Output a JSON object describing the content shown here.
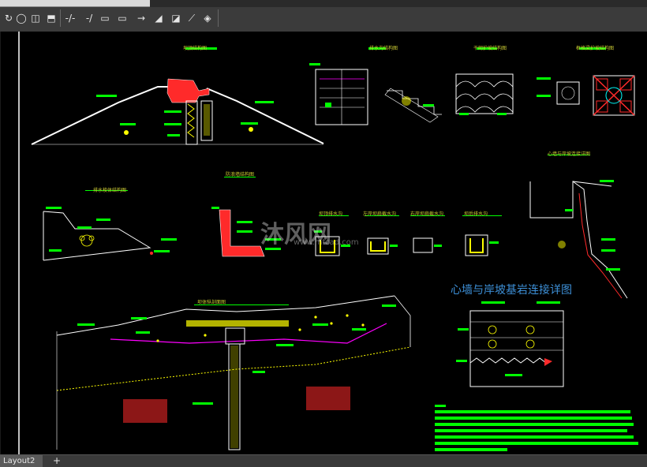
{
  "toolbar": {
    "tools": [
      "redo-icon",
      "undo-icon",
      "extra-icon",
      "cursor-icon",
      "orbit-icon",
      "rectangle-icon",
      "insert-icon",
      "trim-icon",
      "extend-icon",
      "break-icon",
      "join-icon",
      "chamfer-icon",
      "fillet-icon",
      "blend-icon",
      "explode-icon",
      "block-icon"
    ]
  },
  "drawing": {
    "headline": "心墙与岸坡基岩连接详图",
    "watermark": "沐风网",
    "watermark_sub": "www.mfcad.com",
    "labels": {
      "dam_section": "坝顶结构图",
      "drain_section": "排水沟结构图",
      "slope_protect": "干砌护坡结构图",
      "grid_slope": "框格梁护坡结构图",
      "downstream": "排水棱体结构图",
      "wave_wall": "防浪墙结构图",
      "ditch1": "坝顶排水沟",
      "ditch2": "左岸坝肩截水沟",
      "ditch3": "右岸坝肩截水沟",
      "ditch4": "坝后排水沟",
      "right_detail": "心墙与岸坡连接详图",
      "section_main": "坝体纵剖面图"
    },
    "colors": {
      "green": "#00ff00",
      "yellow": "#ffff00",
      "red": "#ff2a2a",
      "white": "#ffffff",
      "magenta": "#ff00ff",
      "cyan": "#00ffff",
      "blue": "#3d8fd6"
    }
  },
  "statusbar": {
    "tab_label": "Layout2",
    "add_tab": "+"
  }
}
